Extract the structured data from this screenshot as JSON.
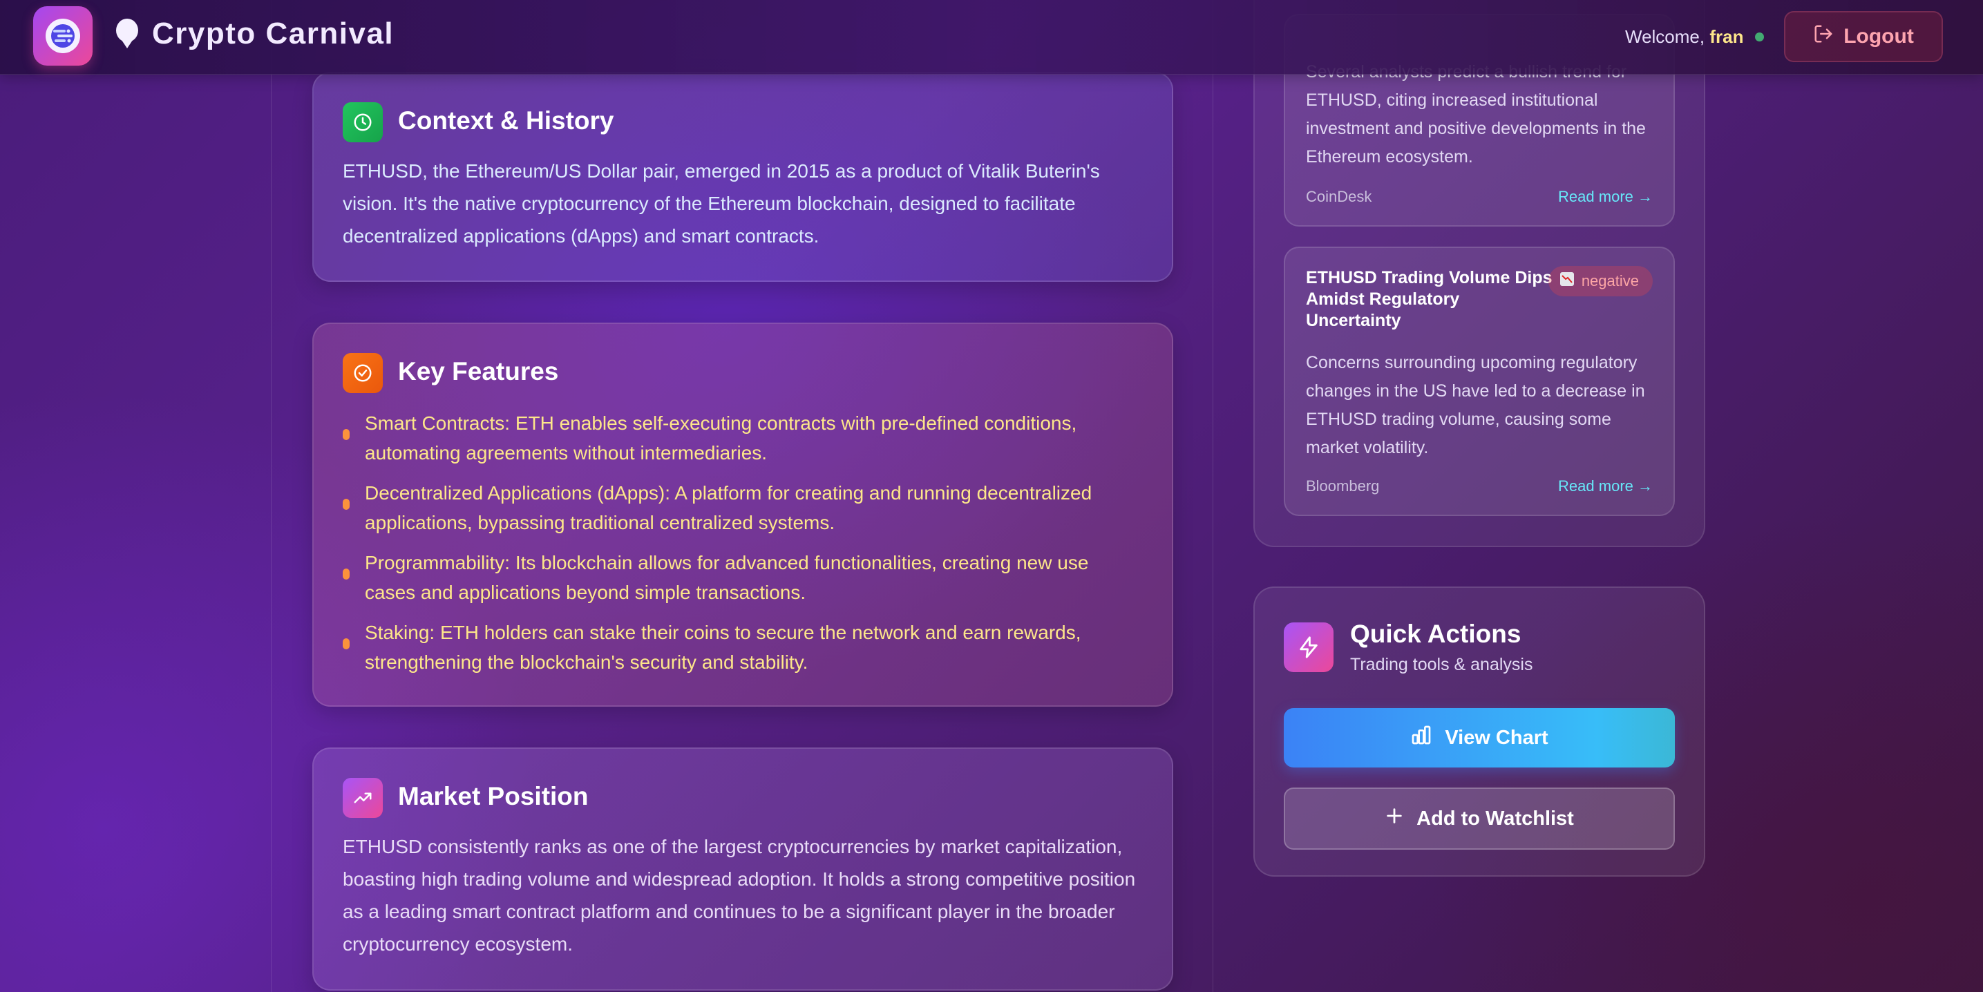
{
  "header": {
    "app_title": "Crypto Carnival",
    "welcome_prefix": "Welcome,",
    "username": "fran",
    "logout_label": "Logout"
  },
  "context": {
    "title": "Context & History",
    "body": "ETHUSD, the Ethereum/US Dollar pair, emerged in 2015 as a product of Vitalik Buterin's vision. It's the native cryptocurrency of the Ethereum blockchain, designed to facilitate decentralized applications (dApps) and smart contracts."
  },
  "features": {
    "title": "Key Features",
    "items": [
      "Smart Contracts: ETH enables self-executing contracts with pre-defined conditions, automating agreements without intermediaries.",
      "Decentralized Applications (dApps): A platform for creating and running decentralized applications, bypassing traditional centralized systems.",
      "Programmability: Its blockchain allows for advanced functionalities, creating new use cases and applications beyond simple transactions.",
      "Staking: ETH holders can stake their coins to secure the network and earn rewards, strengthening the blockchain's security and stability."
    ]
  },
  "market": {
    "title": "Market Position",
    "body": "ETHUSD consistently ranks as one of the largest cryptocurrencies by market capitalization, boasting high trading volume and widespread adoption. It holds a strong competitive position as a leading smart contract platform and continues to be a significant player in the broader cryptocurrency ecosystem."
  },
  "news": [
    {
      "summary": "Several analysts predict a bullish trend for ETHUSD, citing increased institutional investment and positive developments in the Ethereum ecosystem.",
      "source": "CoinDesk",
      "read_more": "Read more →"
    },
    {
      "title": "ETHUSD Trading Volume Dips Amidst Regulatory Uncertainty",
      "sentiment": "negative",
      "summary": "Concerns surrounding upcoming regulatory changes in the US have led to a decrease in ETHUSD trading volume, causing some market volatility.",
      "source": "Bloomberg",
      "read_more": "Read more →"
    }
  ],
  "quick_actions": {
    "title": "Quick Actions",
    "subtitle": "Trading tools & analysis",
    "view_chart_label": "View Chart",
    "watchlist_label": "Add to Watchlist"
  },
  "colors": {
    "accent_yellow": "#fde68a",
    "accent_cyan": "#67e8f9",
    "logout_pink": "#fda4af",
    "online_green": "#4ade80"
  },
  "icons": {
    "logo": "globe-logo-icon",
    "context": "clock-icon",
    "features": "check-circle-icon",
    "market": "trending-up-icon",
    "negative": "chart-down-icon",
    "quick_actions": "lightning-icon",
    "view_chart": "bar-chart-icon",
    "watchlist": "plus-icon",
    "logout": "logout-icon"
  }
}
